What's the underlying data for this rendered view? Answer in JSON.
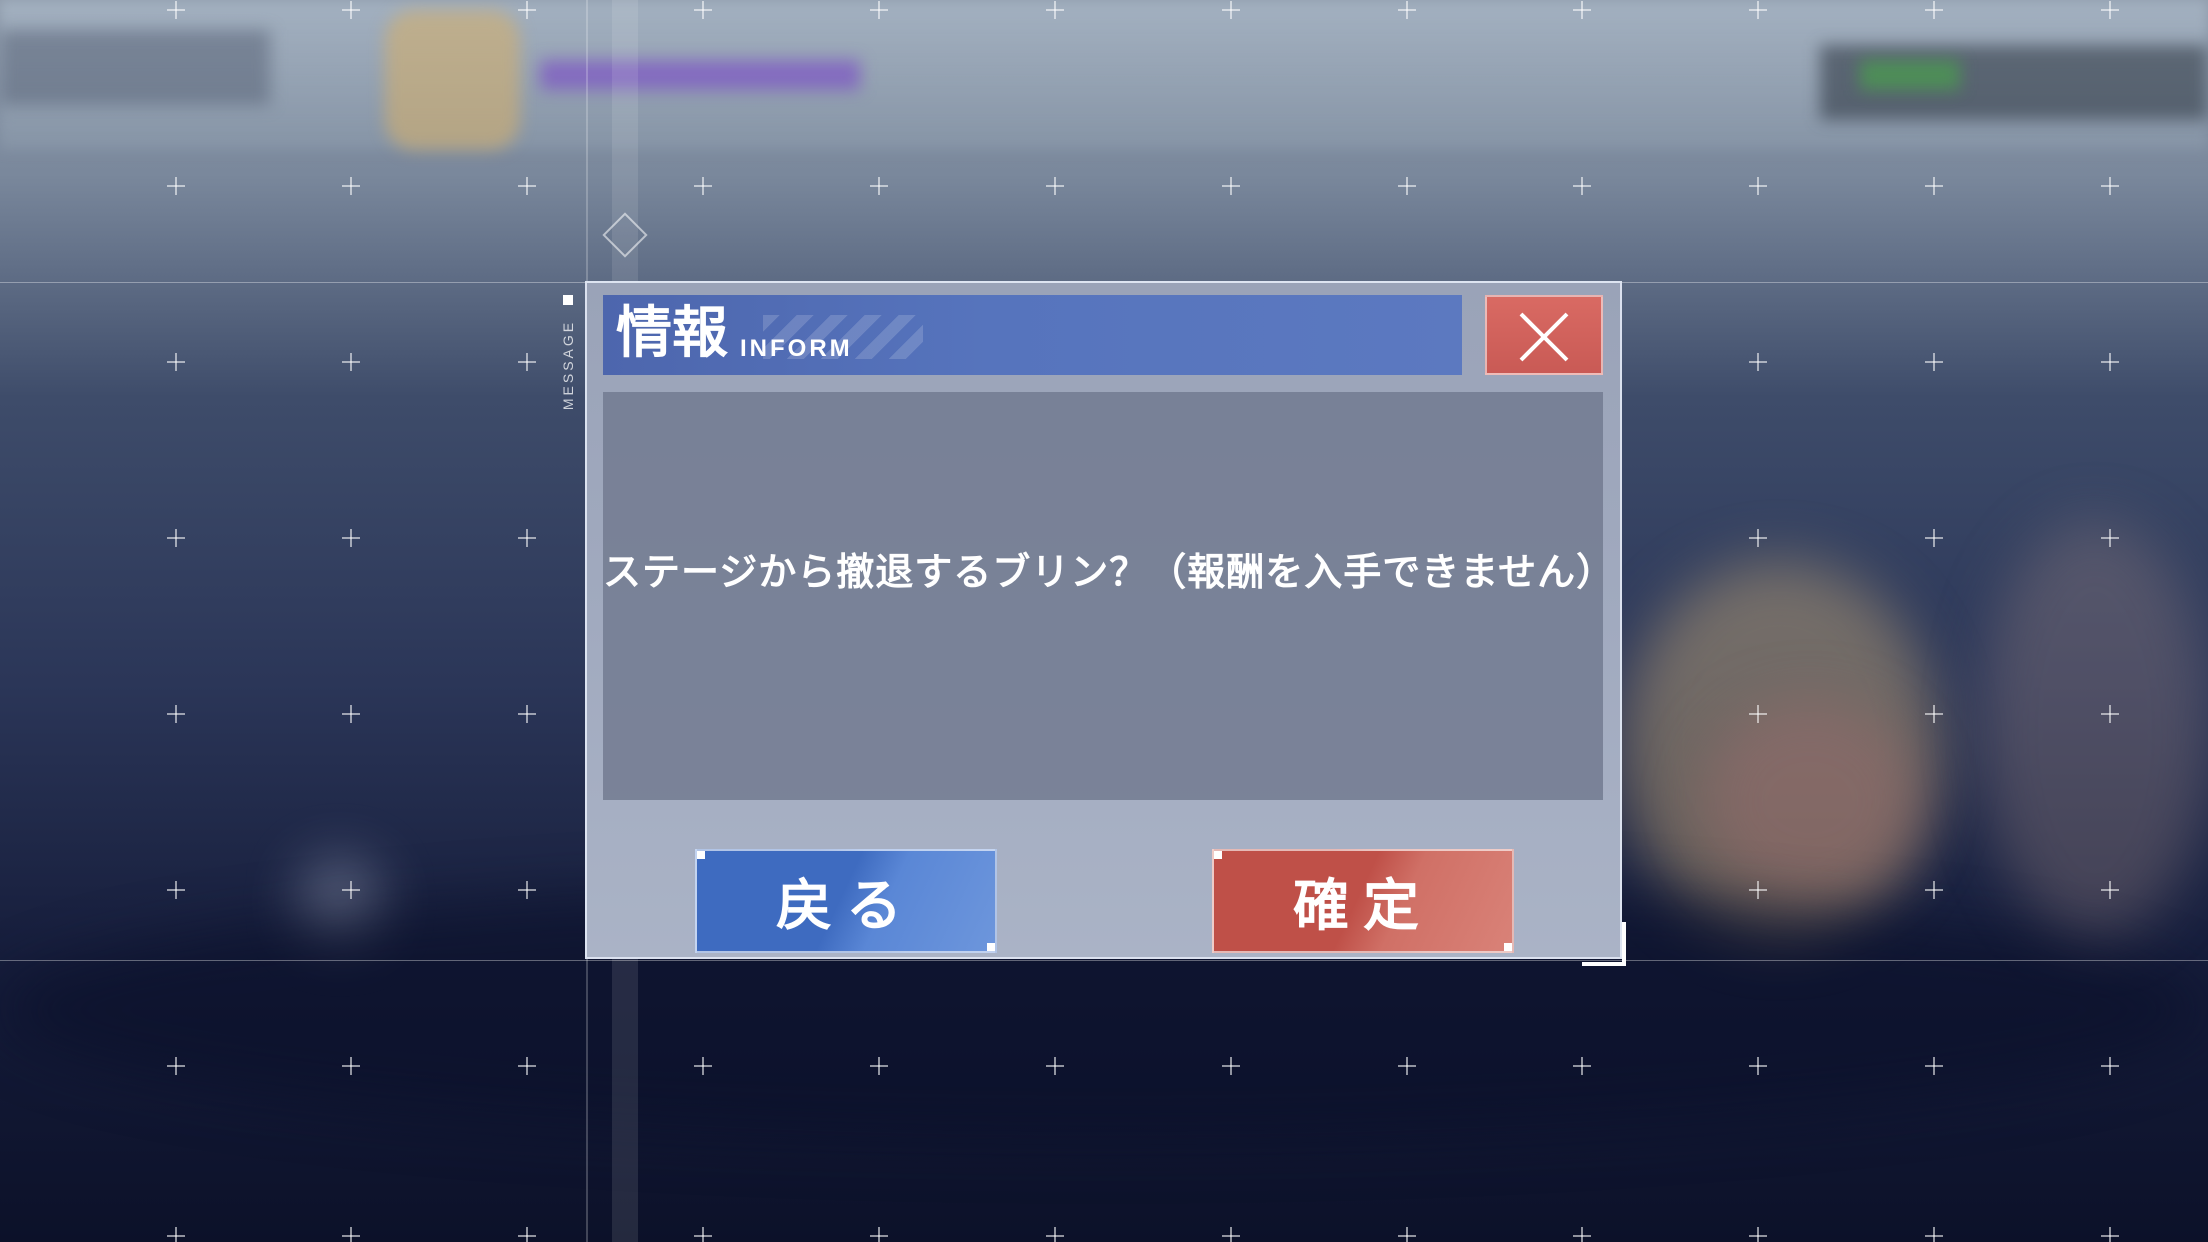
{
  "dialog": {
    "side_tag": "MESSAGE",
    "title": "情報",
    "subtitle": "INFORM",
    "message": "ステージから撤退するブリン？（報酬を入手できません）",
    "back_label": "戻る",
    "confirm_label": "確定",
    "close_icon": "close-icon"
  },
  "colors": {
    "title_bar": "#5674bd",
    "close_button": "#d96a63",
    "back_button": "#3e6bc0",
    "confirm_button": "#bf5048"
  }
}
